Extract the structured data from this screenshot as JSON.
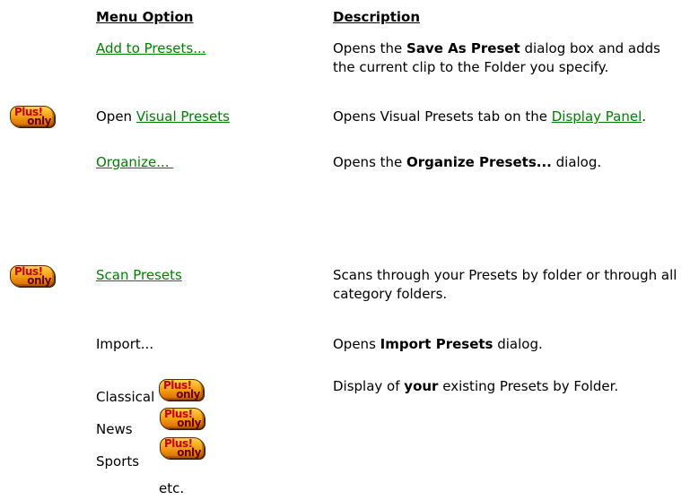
{
  "headers": {
    "menu_option": "Menu Option",
    "description": "Description"
  },
  "rows": {
    "add": {
      "option_link": "Add to Presets...",
      "desc_pre": "Opens the ",
      "desc_bold": "Save As Preset",
      "desc_post": " dialog box and adds the current clip to the Folder you specify."
    },
    "visual": {
      "option_text": "Open ",
      "option_link": "Visual Presets",
      "desc_pre": "Opens Visual Presets tab on the ",
      "desc_link": "Display Panel",
      "desc_post": "."
    },
    "organize": {
      "option_link": "Organize... ",
      "desc_pre": "Opens the ",
      "desc_bold": "Organize Presets...",
      "desc_post": " dialog."
    },
    "scan": {
      "option_link": "Scan Presets",
      "desc": "Scans through your Presets by folder or through all category folders."
    },
    "import": {
      "option_text": "Import...",
      "desc_pre": "Opens ",
      "desc_bold": "Import Presets",
      "desc_post": " dialog."
    },
    "folders": {
      "items": [
        "Classical",
        "News",
        "Sports",
        "etc."
      ],
      "desc_pre": "Display of ",
      "desc_bold": "your",
      "desc_post": " existing Presets by Folder."
    }
  },
  "badge": {
    "line1": "Plus!",
    "line2": "only"
  },
  "colors": {
    "link": "#008000",
    "text": "#000000",
    "background": "#ffffff"
  }
}
